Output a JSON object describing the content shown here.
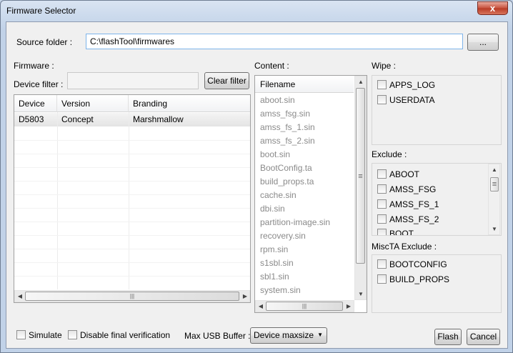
{
  "window": {
    "title": "Firmware Selector",
    "close_glyph": "x"
  },
  "source": {
    "label": "Source folder :",
    "path": "C:\\flashTool\\firmwares",
    "browse_label": "..."
  },
  "firmware": {
    "label": "Firmware :",
    "filter_label": "Device filter :",
    "filter_value": "",
    "clear_label": "Clear filter",
    "columns": [
      "Device",
      "Version",
      "Branding"
    ],
    "rows": [
      {
        "device": "D5803",
        "version": "Concept",
        "branding": "Marshmallow"
      }
    ]
  },
  "content": {
    "label": "Content :",
    "header": "Filename",
    "files": [
      "aboot.sin",
      "amss_fsg.sin",
      "amss_fs_1.sin",
      "amss_fs_2.sin",
      "boot.sin",
      "BootConfig.ta",
      "build_props.ta",
      "cache.sin",
      "dbi.sin",
      "partition-image.sin",
      "recovery.sin",
      "rpm.sin",
      "s1sbl.sin",
      "sbl1.sin",
      "system.sin"
    ]
  },
  "wipe": {
    "label": "Wipe :",
    "items": [
      "APPS_LOG",
      "USERDATA"
    ]
  },
  "exclude": {
    "label": "Exclude :",
    "items": [
      "ABOOT",
      "AMSS_FSG",
      "AMSS_FS_1",
      "AMSS_FS_2",
      "BOOT"
    ]
  },
  "miscta": {
    "label": "MiscTA Exclude :",
    "items": [
      "BOOTCONFIG",
      "BUILD_PROPS"
    ]
  },
  "footer": {
    "simulate_label": "Simulate",
    "disable_verif_label": "Disable final verification",
    "buffer_label": "Max USB Buffer :",
    "buffer_value": "Device maxsize",
    "flash_label": "Flash",
    "cancel_label": "Cancel"
  },
  "icons": {
    "arrow_up": "▲",
    "arrow_down": "▼",
    "arrow_left": "◀",
    "arrow_right": "▶",
    "grip_h": "|||",
    "grip_v": "≡"
  }
}
